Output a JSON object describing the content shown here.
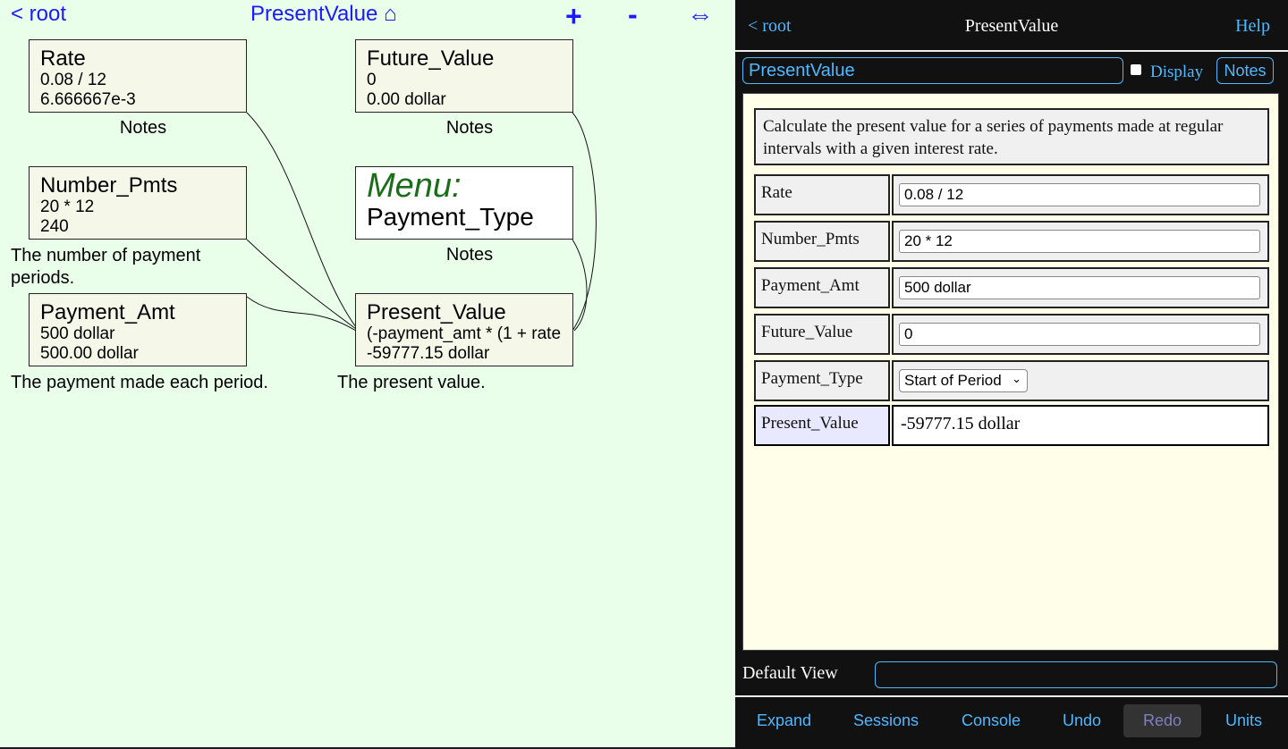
{
  "diagram": {
    "back_label": "< root",
    "title": "PresentValue ⌂",
    "zoom_in_label": "+",
    "zoom_out_label": "-",
    "fit_label": "⇔",
    "nodes": {
      "rate": {
        "name": "Rate",
        "formula": "0.08 / 12",
        "value": "6.666667e-3",
        "note": "Notes"
      },
      "future_value": {
        "name": "Future_Value",
        "formula": "0",
        "value": "0.00 dollar",
        "note": "Notes"
      },
      "number_pmts": {
        "name": "Number_Pmts",
        "formula": "20 * 12",
        "value": "240",
        "note": "The number of payment periods."
      },
      "payment_type": {
        "label": "Menu:",
        "name": "Payment_Type",
        "note": "Notes"
      },
      "payment_amt": {
        "name": "Payment_Amt",
        "formula": "500 dollar",
        "value": "500.00 dollar",
        "note": "The payment made each period."
      },
      "present_value": {
        "name": "Present_Value",
        "formula": "(-payment_amt * (1 + rate",
        "value": "-59777.15 dollar",
        "note": "The present value."
      }
    }
  },
  "panel": {
    "back_label": "< root",
    "title": "PresentValue",
    "help_label": "Help",
    "model_name": "PresentValue",
    "display_label": "Display",
    "notes_label": "Notes",
    "description": "Calculate the present value for  a series of payments made at regular intervals with a given interest rate.",
    "rows": [
      {
        "label": "Rate",
        "value": "0.08 / 12"
      },
      {
        "label": "Number_Pmts",
        "value": "20 * 12"
      },
      {
        "label": "Payment_Amt",
        "value": "500 dollar"
      },
      {
        "label": "Future_Value",
        "value": "0"
      },
      {
        "label": "Payment_Type",
        "value": "Start of Period"
      }
    ],
    "result": {
      "label": "Present_Value",
      "value": "-59777.15 dollar"
    },
    "default_view_label": "Default View",
    "default_view_value": "",
    "footer": [
      "Expand",
      "Sessions",
      "Console",
      "Undo",
      "Redo",
      "Units"
    ]
  },
  "colors": {
    "diagram_bg": "#eaffea",
    "link_blue": "#1a1aff",
    "accent": "#4fb8ff",
    "menu_green": "#1a6e1a",
    "panel_bg": "#fffee8"
  }
}
